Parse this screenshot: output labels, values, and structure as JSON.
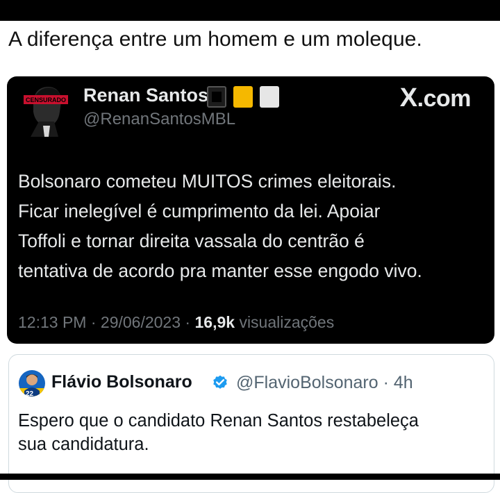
{
  "caption": "A diferença entre um homem e um moleque.",
  "tweet": {
    "author_name": "Renan Santos",
    "avatar_stamp": "CENSURADO",
    "handle": "@RenanSantosMBL",
    "brand": {
      "x": "X",
      "suffix": ".com"
    },
    "body_lines": [
      "Bolsonaro cometeu MUITOS crimes eleitorais.",
      "Ficar inelegível é cumprimento da lei. Apoiar",
      "Toffoli e tornar direita vassala do centrão é",
      "tentativa de acordo pra manter esse engodo vivo."
    ],
    "time": "12:13 PM",
    "date": "29/06/2023",
    "views_count": "16,9k",
    "views_label": "visualizações",
    "separator": "·"
  },
  "quote": {
    "author_name": "Flávio Bolsonaro",
    "avatar_badge": "22",
    "handle_and_time": "@FlavioBolsonaro · 4h",
    "body_lines": [
      "Espero que o candidato Renan Santos restabeleça",
      "sua candidatura."
    ]
  },
  "colors": {
    "tweet_bg": "#000000",
    "tweet_text": "#e7e9ea",
    "muted": "#71767b",
    "verified_blue": "#1d9bf0",
    "square_yellow": "#f5b800",
    "square_white": "#e6e6e6"
  },
  "icons": [
    "censored-avatar-icon",
    "black-square-emoji",
    "yellow-square-emoji",
    "white-square-emoji",
    "verified-badge-icon"
  ]
}
